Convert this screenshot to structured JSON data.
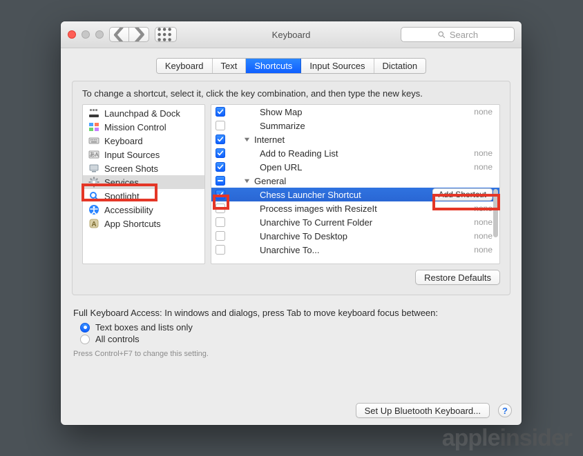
{
  "window": {
    "title": "Keyboard"
  },
  "toolbar": {
    "search_placeholder": "Search"
  },
  "tabs": {
    "items": [
      "Keyboard",
      "Text",
      "Shortcuts",
      "Input Sources",
      "Dictation"
    ],
    "active_index": 2
  },
  "panel": {
    "instruction": "To change a shortcut, select it, click the key combination, and then type the new keys.",
    "categories": [
      "Launchpad & Dock",
      "Mission Control",
      "Keyboard",
      "Input Sources",
      "Screen Shots",
      "Services",
      "Spotlight",
      "Accessibility",
      "App Shortcuts"
    ],
    "selected_category_index": 5,
    "tree": [
      {
        "type": "item",
        "indent": 2,
        "checked": true,
        "label": "Show Map",
        "shortcut": "none"
      },
      {
        "type": "item",
        "indent": 2,
        "checked": false,
        "label": "Summarize",
        "shortcut": ""
      },
      {
        "type": "group",
        "indent": 1,
        "checked": true,
        "label": "Internet"
      },
      {
        "type": "item",
        "indent": 2,
        "checked": true,
        "label": "Add to Reading List",
        "shortcut": "none"
      },
      {
        "type": "item",
        "indent": 2,
        "checked": true,
        "label": "Open URL",
        "shortcut": "none"
      },
      {
        "type": "group",
        "indent": 1,
        "checked": "mixed",
        "label": "General"
      },
      {
        "type": "item",
        "indent": 2,
        "checked": true,
        "label": "Chess Launcher Shortcut",
        "shortcut": "",
        "selected": true,
        "add_shortcut": true
      },
      {
        "type": "item",
        "indent": 2,
        "checked": false,
        "label": "Process images with ResizeIt",
        "shortcut": "none"
      },
      {
        "type": "item",
        "indent": 2,
        "checked": false,
        "label": "Unarchive To Current Folder",
        "shortcut": "none"
      },
      {
        "type": "item",
        "indent": 2,
        "checked": false,
        "label": "Unarchive To Desktop",
        "shortcut": "none"
      },
      {
        "type": "item",
        "indent": 2,
        "checked": false,
        "label": "Unarchive To...",
        "shortcut": "none"
      }
    ],
    "add_shortcut_label": "Add Shortcut",
    "restore_defaults": "Restore Defaults"
  },
  "fka": {
    "title": "Full Keyboard Access: In windows and dialogs, press Tab to move keyboard focus between:",
    "options": [
      "Text boxes and lists only",
      "All controls"
    ],
    "selected_index": 0,
    "hint": "Press Control+F7 to change this setting."
  },
  "bottom": {
    "setup_bt": "Set Up Bluetooth Keyboard...",
    "help": "?"
  },
  "watermark": {
    "a": "apple",
    "b": "insider"
  }
}
